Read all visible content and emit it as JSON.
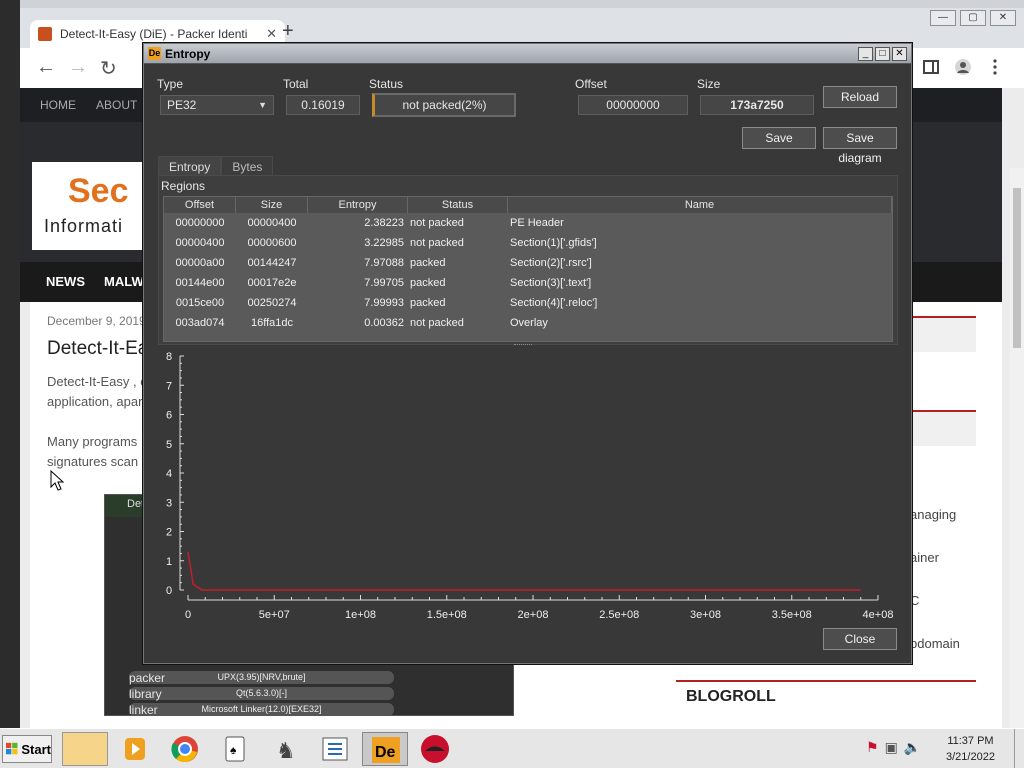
{
  "browser": {
    "tab_title": "Detect-It-Easy (DiE) - Packer Identi",
    "tab_close": "✕",
    "new_tab": "+",
    "window_controls": [
      "—",
      "▢",
      "✕"
    ]
  },
  "site": {
    "nav": [
      "HOME",
      "ABOUT"
    ],
    "logo_sec": "Sec",
    "logo_info": "Informati",
    "menu": [
      "NEWS",
      "MALWA"
    ],
    "date": "December 9, 2019",
    "title": "Detect-It-Eas",
    "p1a": "Detect-It-Easy , c",
    "p1b": "application, apar",
    "p2a": "Many programs",
    "p2b": "signatures scan",
    "sidebar_texts": [
      "anaging",
      "ainer",
      "C",
      "bdomain"
    ],
    "blogroll": "BLOGROLL"
  },
  "die_behind": {
    "title": "Dete",
    "rows": [
      {
        "label": "packer",
        "value": "UPX(3.95)[NRV,brute]"
      },
      {
        "label": "library",
        "value": "Qt(5.6.3.0)[-]"
      },
      {
        "label": "linker",
        "value": "Microsoft Linker(12.0)[EXE32]"
      }
    ]
  },
  "window": {
    "title": "Entropy",
    "icon": "De",
    "labels": {
      "type": "Type",
      "total": "Total",
      "status": "Status",
      "offset": "Offset",
      "size": "Size"
    },
    "type_value": "PE32",
    "total_value": "0.16019",
    "status_value": "not packed(2%)",
    "offset_value": "00000000",
    "size_value": "173a7250",
    "buttons": {
      "reload": "Reload",
      "save": "Save",
      "save_diagram": "Save diagram",
      "close": "Close"
    },
    "tabs": [
      "Entropy",
      "Bytes"
    ],
    "regions_label": "Regions",
    "table": {
      "headers": [
        "Offset",
        "Size",
        "Entropy",
        "Status",
        "Name"
      ],
      "rows": [
        [
          "00000000",
          "00000400",
          "2.38223",
          "not packed",
          "PE Header"
        ],
        [
          "00000400",
          "00000600",
          "3.22985",
          "not packed",
          "Section(1)['.gfids']"
        ],
        [
          "00000a00",
          "00144247",
          "7.97088",
          "packed",
          "Section(2)['.rsrc']"
        ],
        [
          "00144e00",
          "00017e2e",
          "7.99705",
          "packed",
          "Section(3)['.text']"
        ],
        [
          "0015ce00",
          "00250274",
          "7.99993",
          "packed",
          "Section(4)['.reloc']"
        ],
        [
          "003ad074",
          "16ffa1dc",
          "0.00362",
          "not packed",
          "Overlay"
        ]
      ]
    }
  },
  "chart_data": {
    "type": "line",
    "xlim": [
      0,
      400000000
    ],
    "ylim": [
      0,
      8
    ],
    "x_ticks": [
      "0",
      "5e+07",
      "1e+08",
      "1.5e+08",
      "2e+08",
      "2.5e+08",
      "3e+08",
      "3.5e+08",
      "4e+08"
    ],
    "y_ticks": [
      "0",
      "1",
      "2",
      "3",
      "4",
      "5",
      "6",
      "7",
      "8"
    ],
    "series": [
      {
        "color": "#c0202a",
        "x": [
          0,
          3000000,
          8000000,
          390000000
        ],
        "y": [
          1.3,
          0.2,
          0.0,
          0.0
        ]
      }
    ]
  },
  "taskbar": {
    "start": "Start",
    "time": "11:37 PM",
    "date": "3/21/2022"
  },
  "colors": {
    "window_bg": "#383838",
    "line": "#c0202a",
    "accent": "#c58b2c"
  }
}
